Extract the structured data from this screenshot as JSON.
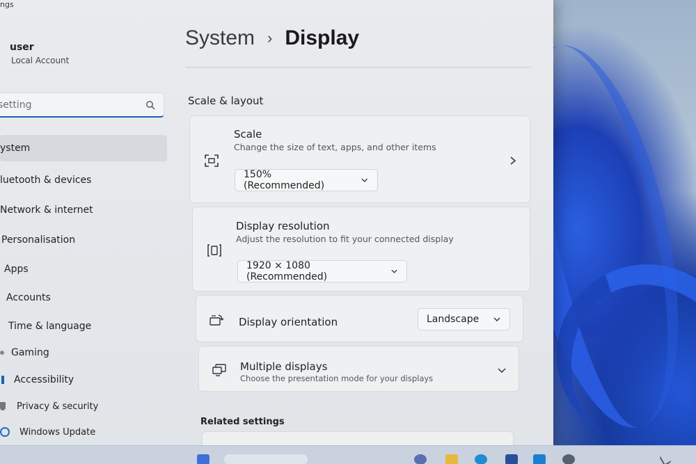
{
  "app": {
    "title": "ngs"
  },
  "user": {
    "name": "user",
    "account_type": "Local Account"
  },
  "search": {
    "placeholder": "setting"
  },
  "sidebar": {
    "items": [
      {
        "label": "ystem",
        "selected": true
      },
      {
        "label": "luetooth & devices"
      },
      {
        "label": "Network & internet"
      },
      {
        "label": "Personalisation"
      },
      {
        "label": "Apps"
      },
      {
        "label": "Accounts"
      },
      {
        "label": "Time & language"
      },
      {
        "label": "Gaming"
      },
      {
        "label": "Accessibility"
      },
      {
        "label": "Privacy & security"
      },
      {
        "label": "Windows Update"
      }
    ]
  },
  "breadcrumb": {
    "parent": "System",
    "separator": "›",
    "current": "Display"
  },
  "scale_layout": {
    "section_title": "Scale & layout",
    "scale": {
      "title": "Scale",
      "subtitle": "Change the size of text, apps, and other items",
      "value": "150% (Recommended)"
    },
    "resolution": {
      "title": "Display resolution",
      "subtitle": "Adjust the resolution to fit your connected display",
      "value": "1920 × 1080 (Recommended)"
    },
    "orientation": {
      "title": "Display orientation",
      "value": "Landscape"
    },
    "multiple": {
      "title": "Multiple displays",
      "subtitle": "Choose the presentation mode for your displays"
    }
  },
  "related": {
    "section_title": "Related settings"
  },
  "colors": {
    "accent": "#1f5fb8",
    "window_bg": "#e6e8eb",
    "card_bg": "#eef0f2"
  }
}
